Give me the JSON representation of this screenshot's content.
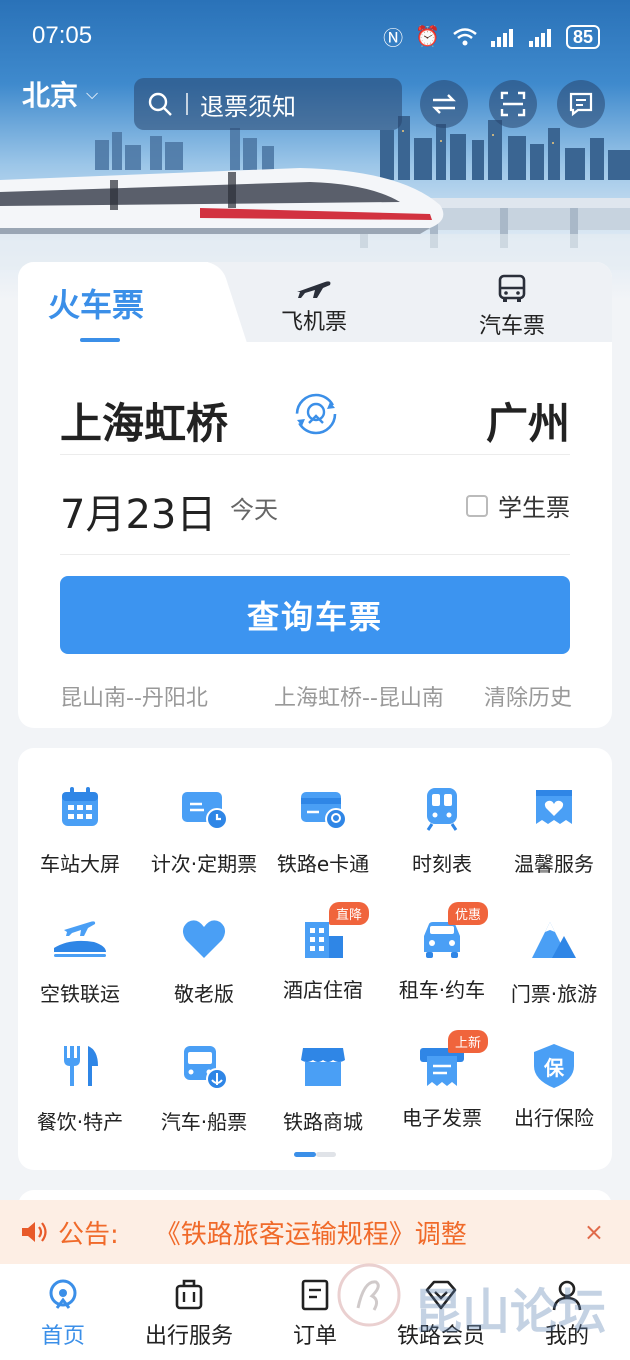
{
  "status_bar": {
    "time": "07:05",
    "battery": "85"
  },
  "header": {
    "city": "北京",
    "search_placeholder": "退票须知",
    "icons": [
      "swap-icon",
      "scan-icon",
      "message-icon"
    ]
  },
  "ticket_tabs": [
    {
      "label": "火车票",
      "active": true
    },
    {
      "label": "飞机票",
      "icon": "plane-icon"
    },
    {
      "label": "汽车票",
      "icon": "bus-icon"
    }
  ],
  "route": {
    "from": "上海虹桥",
    "to": "广州"
  },
  "date": {
    "value": "7月23日",
    "day_label": "今天"
  },
  "student_ticket": {
    "label": "学生票",
    "checked": false
  },
  "query_button": "查询车票",
  "history": {
    "items": [
      "昆山南--丹阳北",
      "上海虹桥--昆山南"
    ],
    "clear_label": "清除历史"
  },
  "services": [
    {
      "label": "车站大屏",
      "icon": "calendar-grid-icon"
    },
    {
      "label": "计次·定期票",
      "icon": "ticket-card-icon"
    },
    {
      "label": "铁路e卡通",
      "icon": "rail-card-icon"
    },
    {
      "label": "时刻表",
      "icon": "train-front-icon"
    },
    {
      "label": "温馨服务",
      "icon": "heart-ticket-icon"
    },
    {
      "label": "空铁联运",
      "icon": "plane-train-icon"
    },
    {
      "label": "敬老版",
      "icon": "heart-icon"
    },
    {
      "label": "酒店住宿",
      "icon": "hotel-icon",
      "badge": "直降"
    },
    {
      "label": "租车·约车",
      "icon": "car-icon",
      "badge": "优惠"
    },
    {
      "label": "门票·旅游",
      "icon": "mountain-icon"
    },
    {
      "label": "餐饮·特产",
      "icon": "fork-knife-icon"
    },
    {
      "label": "汽车·船票",
      "icon": "bus-anchor-icon"
    },
    {
      "label": "铁路商城",
      "icon": "shop-icon"
    },
    {
      "label": "电子发票",
      "icon": "invoice-icon",
      "badge": "上新"
    },
    {
      "label": "出行保险",
      "icon": "insurance-shield-icon",
      "shield_text": "保"
    }
  ],
  "notice": {
    "label": "公告:",
    "message": "《铁路旅客运输规程》调整",
    "close": "×"
  },
  "bottom_nav": [
    {
      "label": "首页",
      "active": true,
      "icon": "home-rail-icon"
    },
    {
      "label": "出行服务",
      "icon": "luggage-icon"
    },
    {
      "label": "订单",
      "icon": "order-icon"
    },
    {
      "label": "铁路会员",
      "icon": "diamond-icon"
    },
    {
      "label": "我的",
      "icon": "user-icon"
    }
  ],
  "watermark": "昆山论坛",
  "colors": {
    "accent": "#3b8fe8",
    "notice": "#f06a2a",
    "badge": "#f0643c"
  }
}
